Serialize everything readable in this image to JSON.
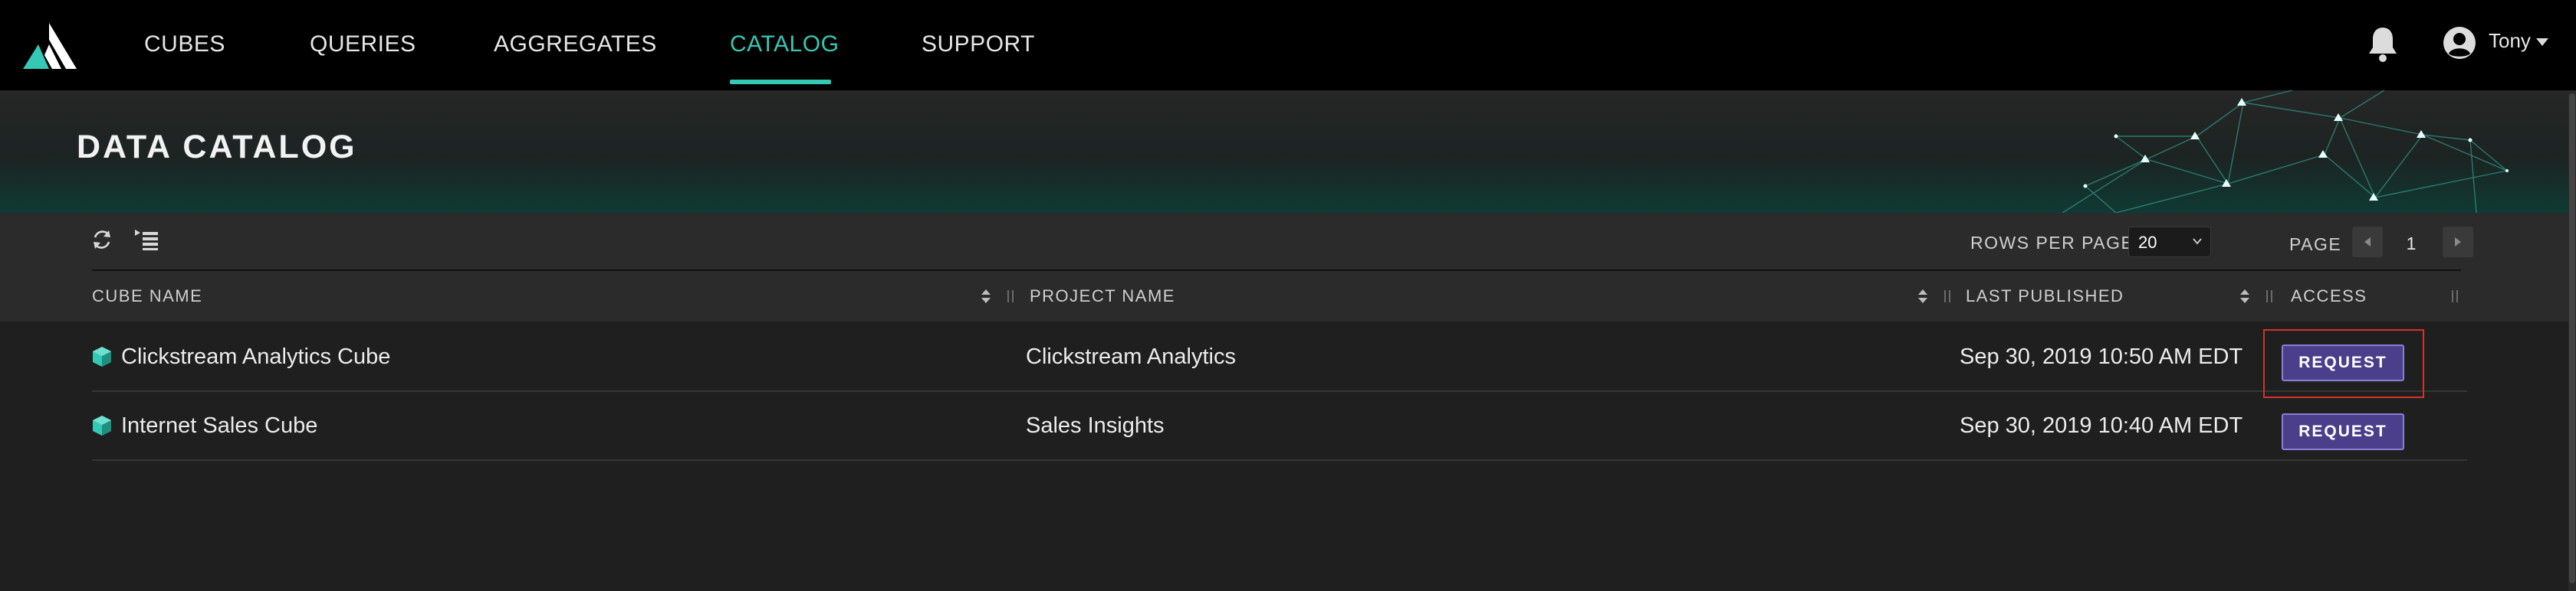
{
  "nav": {
    "items": [
      {
        "label": "CUBES",
        "active": false
      },
      {
        "label": "QUERIES",
        "active": false
      },
      {
        "label": "AGGREGATES",
        "active": false
      },
      {
        "label": "CATALOG",
        "active": true
      },
      {
        "label": "SUPPORT",
        "active": false
      }
    ],
    "user": "Tony",
    "icons": [
      "logo-icon",
      "bell-icon",
      "user-avatar-icon",
      "caret-down-icon"
    ]
  },
  "banner": {
    "title": "DATA CATALOG"
  },
  "toolbar": {
    "icons": [
      "refresh-icon",
      "column-list-icon"
    ],
    "rows_per_page_label": "ROWS PER PAGE",
    "rows_per_page_value": "20",
    "page_label": "PAGE",
    "page_number": "1"
  },
  "table": {
    "columns": [
      "CUBE NAME",
      "PROJECT NAME",
      "LAST PUBLISHED",
      "ACCESS"
    ],
    "rows": [
      {
        "cube": "Clickstream Analytics Cube",
        "project": "Clickstream Analytics",
        "published": "Sep 30, 2019 10:50 AM EDT",
        "access": "REQUEST"
      },
      {
        "cube": "Internet Sales Cube",
        "project": "Sales Insights",
        "published": "Sep 30, 2019 10:40 AM EDT",
        "access": "REQUEST"
      }
    ]
  },
  "colors": {
    "accent": "#35c8b4",
    "button": "#4b3f8c",
    "highlight": "#d0342c"
  }
}
